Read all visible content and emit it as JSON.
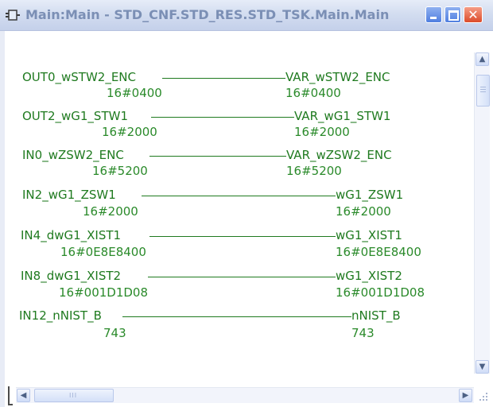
{
  "window": {
    "title": "Main:Main - STD_CNF.STD_RES.STD_TSK.Main.Main",
    "close_glyph": "✕"
  },
  "connections": [
    {
      "source": "OUT0_wSTW2_ENC",
      "source_value": "16#0400",
      "target": "VAR_wSTW2_ENC",
      "target_value": "16#0400"
    },
    {
      "source": "OUT2_wG1_STW1",
      "source_value": "16#2000",
      "target": "VAR_wG1_STW1",
      "target_value": "16#2000"
    },
    {
      "source": "IN0_wZSW2_ENC",
      "source_value": "16#5200",
      "target": "VAR_wZSW2_ENC",
      "target_value": "16#5200"
    },
    {
      "source": "IN2_wG1_ZSW1",
      "source_value": "16#2000",
      "target": "wG1_ZSW1",
      "target_value": "16#2000"
    },
    {
      "source": "IN4_dwG1_XIST1",
      "source_value": "16#0E8E8400",
      "target": "wG1_XIST1",
      "target_value": "16#0E8E8400"
    },
    {
      "source": "IN8_dwG1_XIST2",
      "source_value": "16#001D1D08",
      "target": "wG1_XIST2",
      "target_value": "16#001D1D08"
    },
    {
      "source": "IN12_nNIST_B",
      "source_value": "743",
      "target": "nNIST_B",
      "target_value": "743"
    }
  ],
  "scrollbars": {
    "up_arrow": "▲",
    "down_arrow": "▼",
    "left_arrow": "◀",
    "right_arrow": "▶",
    "thumb_grip": "III"
  },
  "colors": {
    "signal": "#1f7a1f",
    "title_text": "#7b8fb5",
    "close_button": "#dc4b2a"
  }
}
